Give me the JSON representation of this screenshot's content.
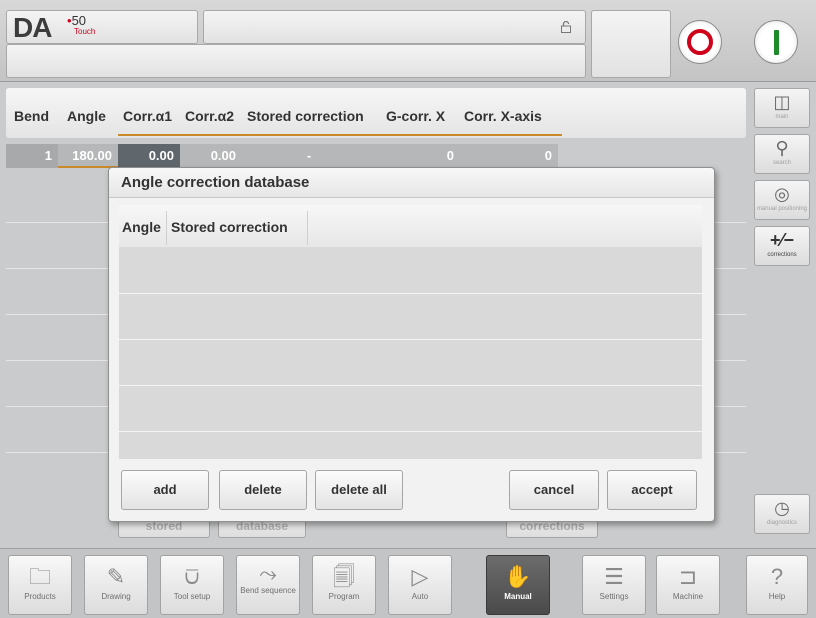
{
  "header": {
    "logo_text": "DA",
    "logo_version": "50",
    "logo_sub": "Touch",
    "title": "",
    "message": ""
  },
  "table": {
    "columns": [
      "Bend",
      "Angle",
      "Corr.α1",
      "Corr.α2",
      "Stored correction",
      "G-corr. X",
      "Corr. X-axis"
    ],
    "row": {
      "bend": "1",
      "angle": "180.00",
      "corr_a1": "0.00",
      "corr_a2": "0.00",
      "stored_correction": "-",
      "g_corr_x": "0",
      "corr_x_axis": "0"
    },
    "bottom_buttons": [
      "stored",
      "database",
      "corrections"
    ]
  },
  "sidebar": {
    "items": [
      {
        "label": "main",
        "icon": "split-view-icon",
        "active": false
      },
      {
        "label": "search",
        "icon": "search-icon",
        "active": false
      },
      {
        "label": "manual positioning",
        "icon": "manual-positioning-icon",
        "active": false
      },
      {
        "label": "corrections",
        "icon": "plus-minus-icon",
        "active": true
      },
      {
        "label": "diagnostics",
        "icon": "diagnostics-icon",
        "active": false
      }
    ]
  },
  "dialog": {
    "title": "Angle correction database",
    "columns": [
      "Angle",
      "Stored correction"
    ],
    "buttons": {
      "add": "add",
      "delete": "delete",
      "delete_all": "delete all",
      "cancel": "cancel",
      "accept": "accept"
    }
  },
  "footer": {
    "nav": [
      {
        "label": "Products",
        "icon": "folder-icon",
        "active": false
      },
      {
        "label": "Drawing",
        "icon": "pencil-icon",
        "active": false
      },
      {
        "label": "Tool setup",
        "icon": "tool-icon",
        "active": false
      },
      {
        "label": "Bend sequence",
        "icon": "bend-sequence-icon",
        "active": false
      },
      {
        "label": "Program",
        "icon": "program-icon",
        "active": false
      },
      {
        "label": "Auto",
        "icon": "play-icon",
        "active": false
      },
      {
        "label": "Manual",
        "icon": "hand-icon",
        "active": true
      },
      {
        "label": "Settings",
        "icon": "settings-icon",
        "active": false
      },
      {
        "label": "Machine",
        "icon": "machine-icon",
        "active": false
      },
      {
        "label": "Help",
        "icon": "help-icon",
        "active": false
      }
    ]
  },
  "colors": {
    "accent_orange": "#c98a2b",
    "stop_red": "#d0021b",
    "start_green": "#1f8a2a",
    "active_nav": "#4a4a4a"
  }
}
